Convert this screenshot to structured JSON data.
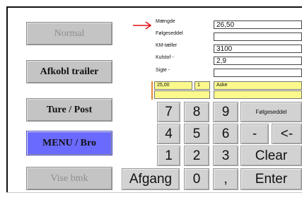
{
  "side_buttons": {
    "normal": "Normal",
    "afkobl_trailer": "Afkobl trailer",
    "ture_post": "Ture / Post",
    "menu_bro": "MENU / Bro",
    "vise_bmk": "Vise bmk"
  },
  "fields": {
    "maengde": {
      "label": "Mængde",
      "value": "26,50"
    },
    "folgeseddel": {
      "label": "Følgeseddel",
      "value": ""
    },
    "km_taeller": {
      "label": "KM-tæller",
      "value": "3100"
    },
    "kulstof": {
      "label": "Kulstof -",
      "value": "2,9"
    },
    "sigte": {
      "label": "Sigte -",
      "value": ""
    }
  },
  "yellow_row": {
    "a": "25,00",
    "b": "1",
    "c": "Aske"
  },
  "keypad": {
    "k7": "7",
    "k8": "8",
    "k9": "9",
    "folgeseddel": "Følgeseddel",
    "k4": "4",
    "k5": "5",
    "k6": "6",
    "minus": "-",
    "backspace": "<-",
    "k1": "1",
    "k2": "2",
    "k3": "3",
    "clear": "Clear",
    "afgang": "Afgang",
    "k0": "0",
    "comma": ",",
    "enter": "Enter"
  },
  "colors": {
    "menu_blue": "#6a6aff",
    "input_yellow": "#fbf98c",
    "arrow_red": "#e01010",
    "marker_orange": "#e58a3a"
  }
}
